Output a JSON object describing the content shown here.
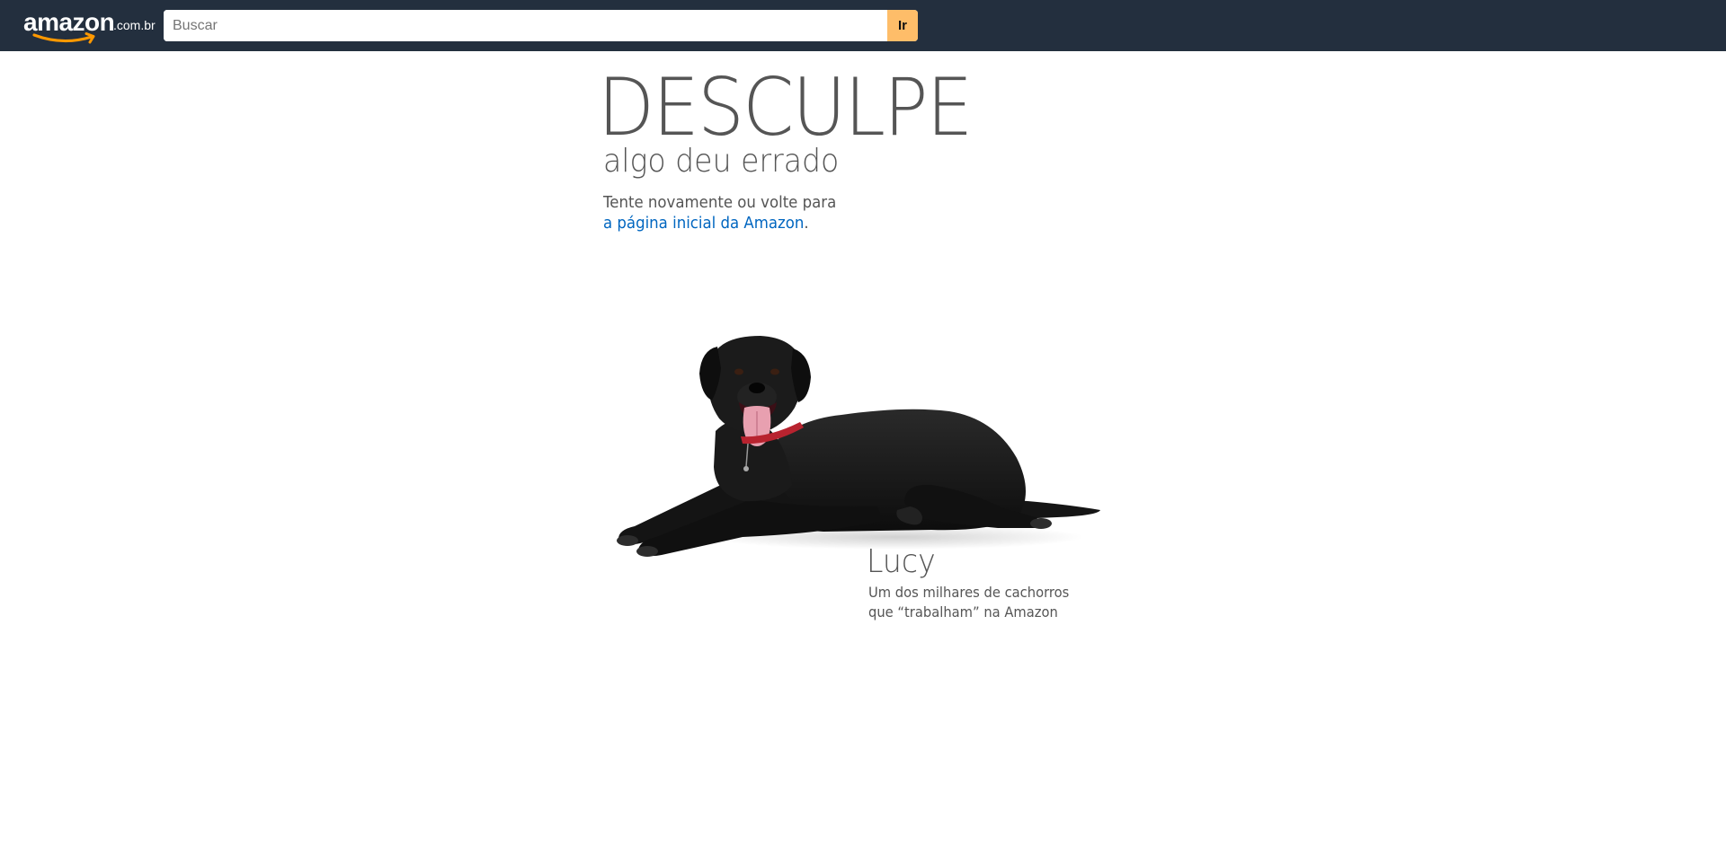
{
  "header": {
    "logo": {
      "word": "amazon",
      "suffix": ".com.br"
    },
    "search": {
      "placeholder": "Buscar",
      "value": "",
      "button_label": "Ir"
    },
    "colors": {
      "bar": "#232f3e",
      "search_button": "#febd69"
    }
  },
  "error": {
    "headline": "DESCULPE",
    "subheadline": "algo deu errado",
    "message_line1": "Tente novamente ou volte para",
    "home_link": "a página inicial da Amazon",
    "message_end": ".",
    "link_color": "#0066c0"
  },
  "dog": {
    "name": "Lucy",
    "caption_line1": "Um dos milhares de cachorros",
    "caption_line2": "que “trabalham” na Amazon"
  }
}
